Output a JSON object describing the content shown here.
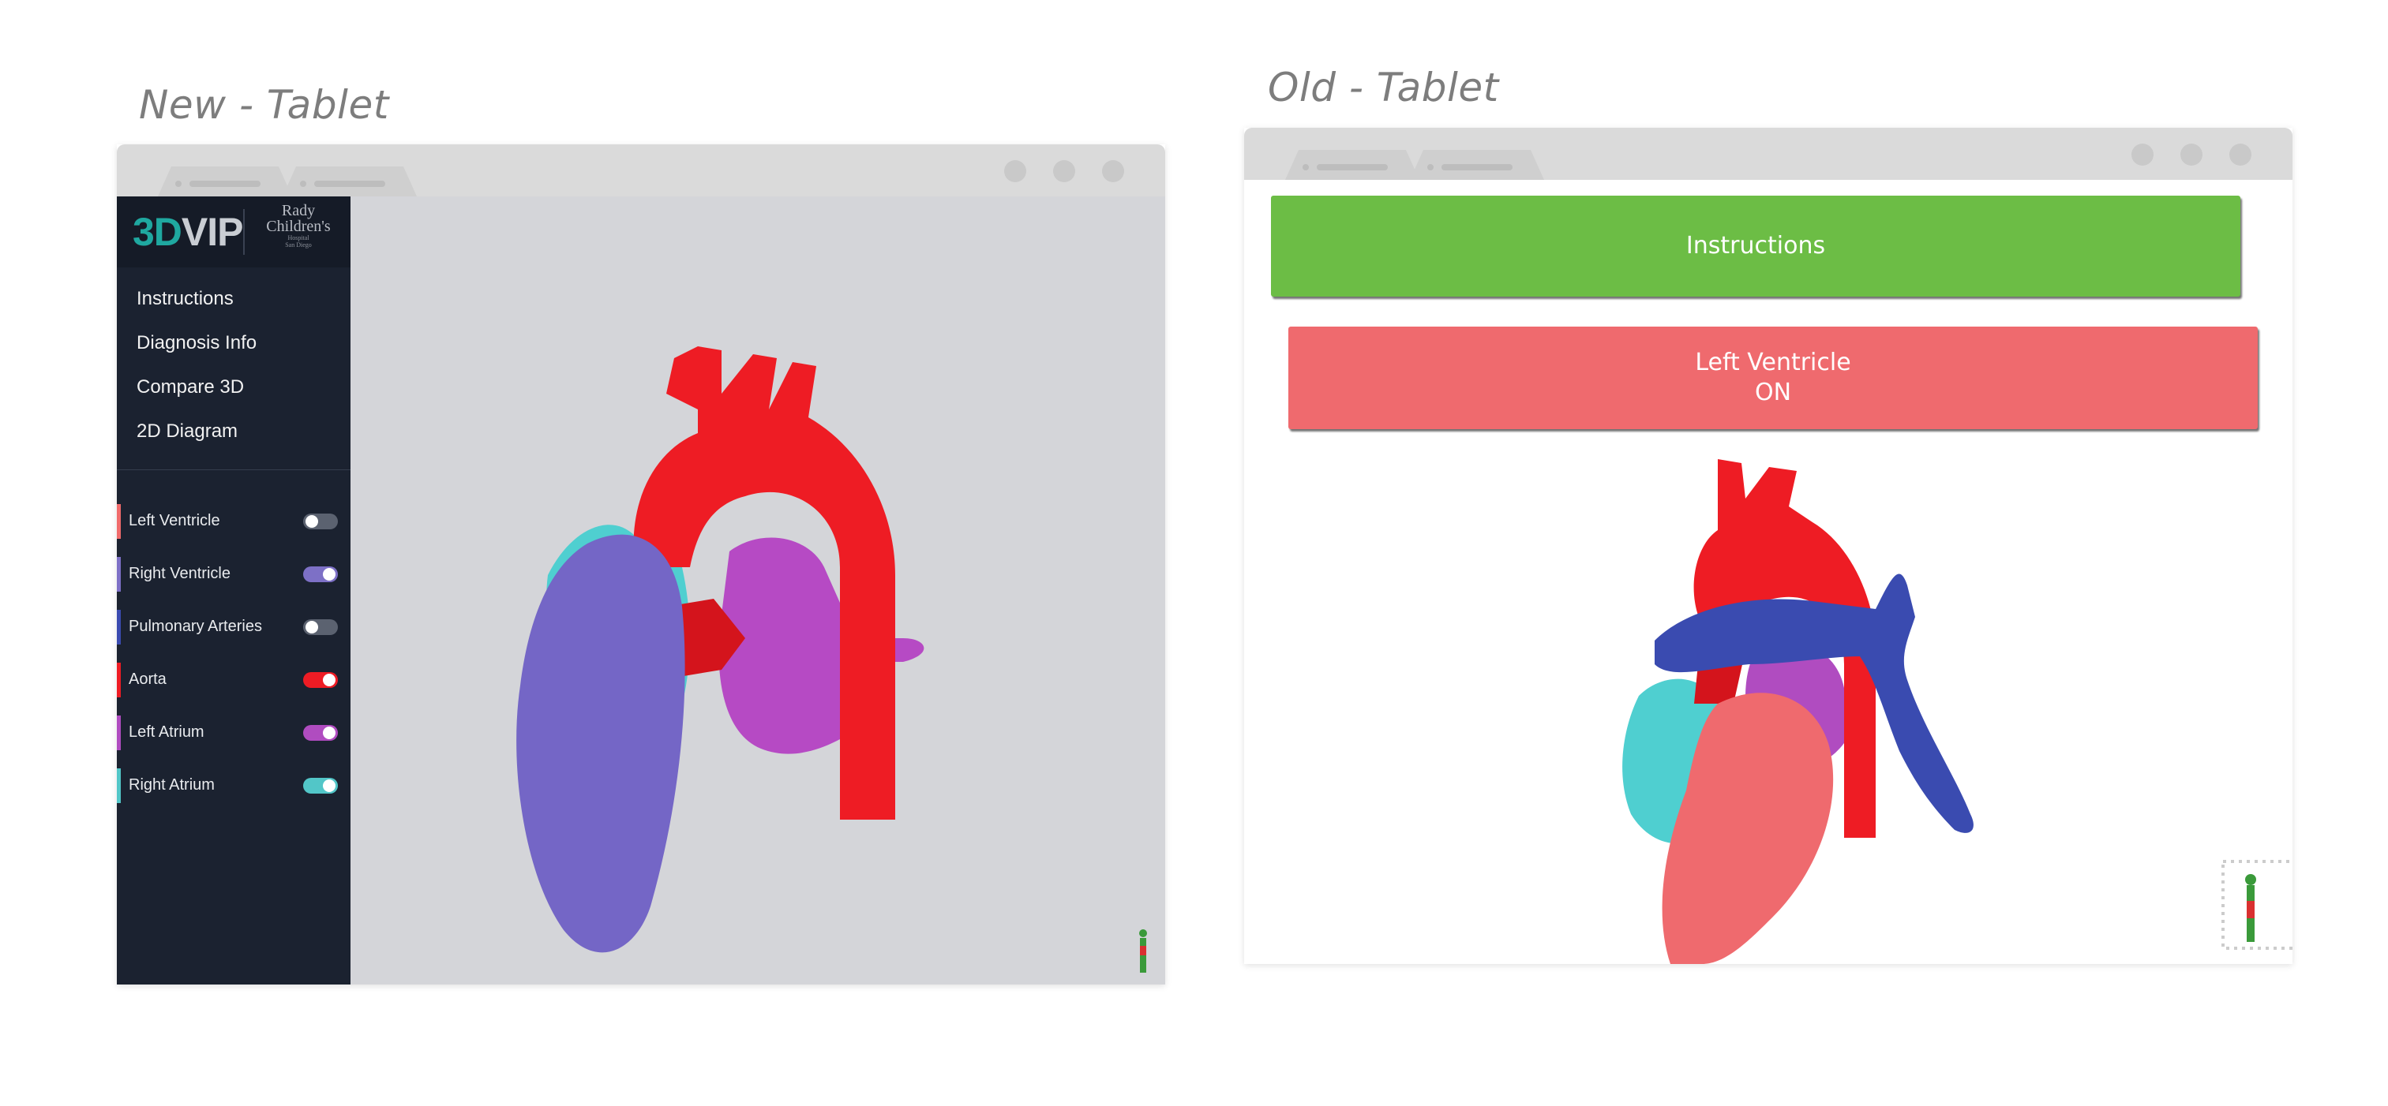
{
  "captions": {
    "new": "New - Tablet",
    "old": "Old - Tablet"
  },
  "new_tablet": {
    "logo_a": "3D",
    "logo_b": "VIP",
    "partner_line1": "Rady",
    "partner_line2": "Children's",
    "partner_small": "Hospital\nSan Diego",
    "nav": [
      "Instructions",
      "Diagnosis Info",
      "Compare 3D",
      "2D Diagram"
    ],
    "layers": [
      {
        "label": "Left Ventricle",
        "color": "#f06b6b",
        "on": false,
        "toggle_color": "#5b6270"
      },
      {
        "label": "Right Ventricle",
        "color": "#7d70c6",
        "on": true,
        "toggle_color": "#7d70c6"
      },
      {
        "label": "Pulmonary Arteries",
        "color": "#3a4bb0",
        "on": false,
        "toggle_color": "#5b6270"
      },
      {
        "label": "Aorta",
        "color": "#ee1c24",
        "on": true,
        "toggle_color": "#ee1c24"
      },
      {
        "label": "Left Atrium",
        "color": "#b04cc0",
        "on": true,
        "toggle_color": "#b04cc0"
      },
      {
        "label": "Right Atrium",
        "color": "#52c6c8",
        "on": true,
        "toggle_color": "#52c6c8"
      }
    ]
  },
  "old_tablet": {
    "instructions_button": "Instructions",
    "left_ventricle_line1": "Left Ventricle",
    "left_ventricle_line2": "ON",
    "instructions_color": "#6cbd45",
    "lv_color": "#ef6a6e"
  }
}
